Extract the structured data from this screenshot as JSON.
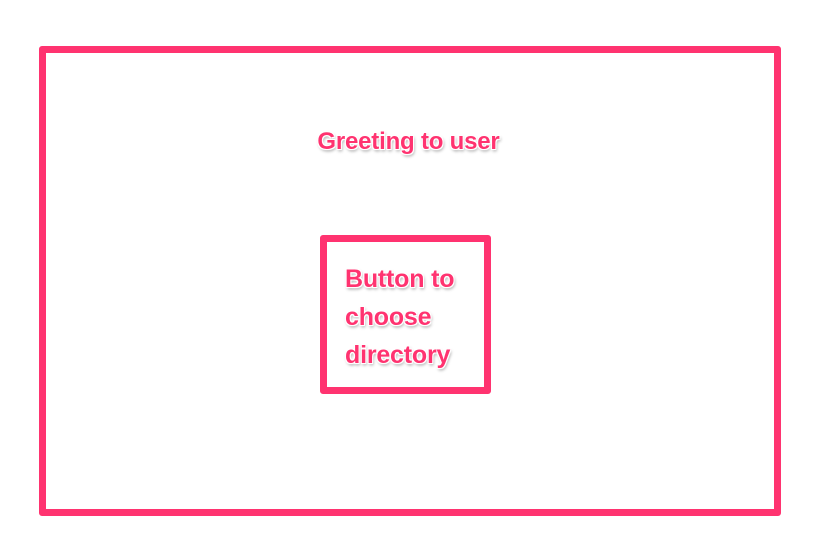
{
  "colors": {
    "accent": "#ff3370",
    "background": "#ffffff"
  },
  "outer_frame": {
    "greeting_label": "Greeting to user"
  },
  "button_box": {
    "label_line1": "Button to",
    "label_line2": "choose",
    "label_line3": "directory"
  }
}
